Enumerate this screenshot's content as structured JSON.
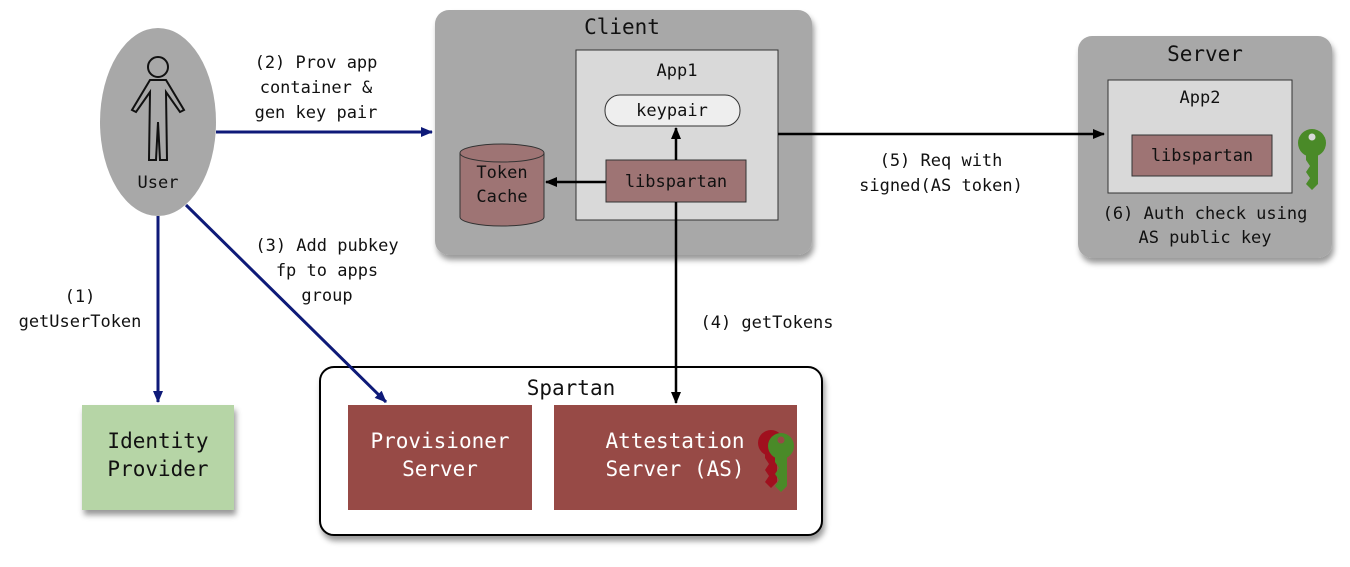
{
  "colors": {
    "container_gray": "#a8a8a8",
    "inner_gray": "#d9d9d9",
    "libspartan": "#9e7474",
    "spartan_box": "#974a46",
    "identity_green": "#b6d5a6",
    "arrow_navy": "#0e1a78",
    "key_green": "#4a8a28",
    "key_red": "#a0101e"
  },
  "user": {
    "label": "User",
    "icon": "person-icon"
  },
  "client": {
    "title": "Client",
    "app1": {
      "title": "App1",
      "keypair": "keypair",
      "libspartan": "libspartan"
    },
    "token_cache": [
      "Token",
      "Cache"
    ]
  },
  "server": {
    "title": "Server",
    "app2": {
      "title": "App2",
      "libspartan": "libspartan"
    },
    "note": [
      "(6) Auth check using",
      "AS public key"
    ]
  },
  "spartan": {
    "title": "Spartan",
    "provisioner": [
      "Provisioner",
      "Server"
    ],
    "attestation": [
      "Attestation",
      "Server (AS)"
    ]
  },
  "identity_provider": [
    "Identity",
    "Provider"
  ],
  "edges": {
    "e1": [
      "(1)",
      "getUserToken"
    ],
    "e2": [
      "(2) Prov app",
      "container &",
      "gen key pair"
    ],
    "e3": [
      "(3) Add pubkey",
      "fp to apps",
      "group"
    ],
    "e4": [
      "(4) getTokens"
    ],
    "e5": [
      "(5) Req with",
      "signed(AS token)"
    ]
  }
}
